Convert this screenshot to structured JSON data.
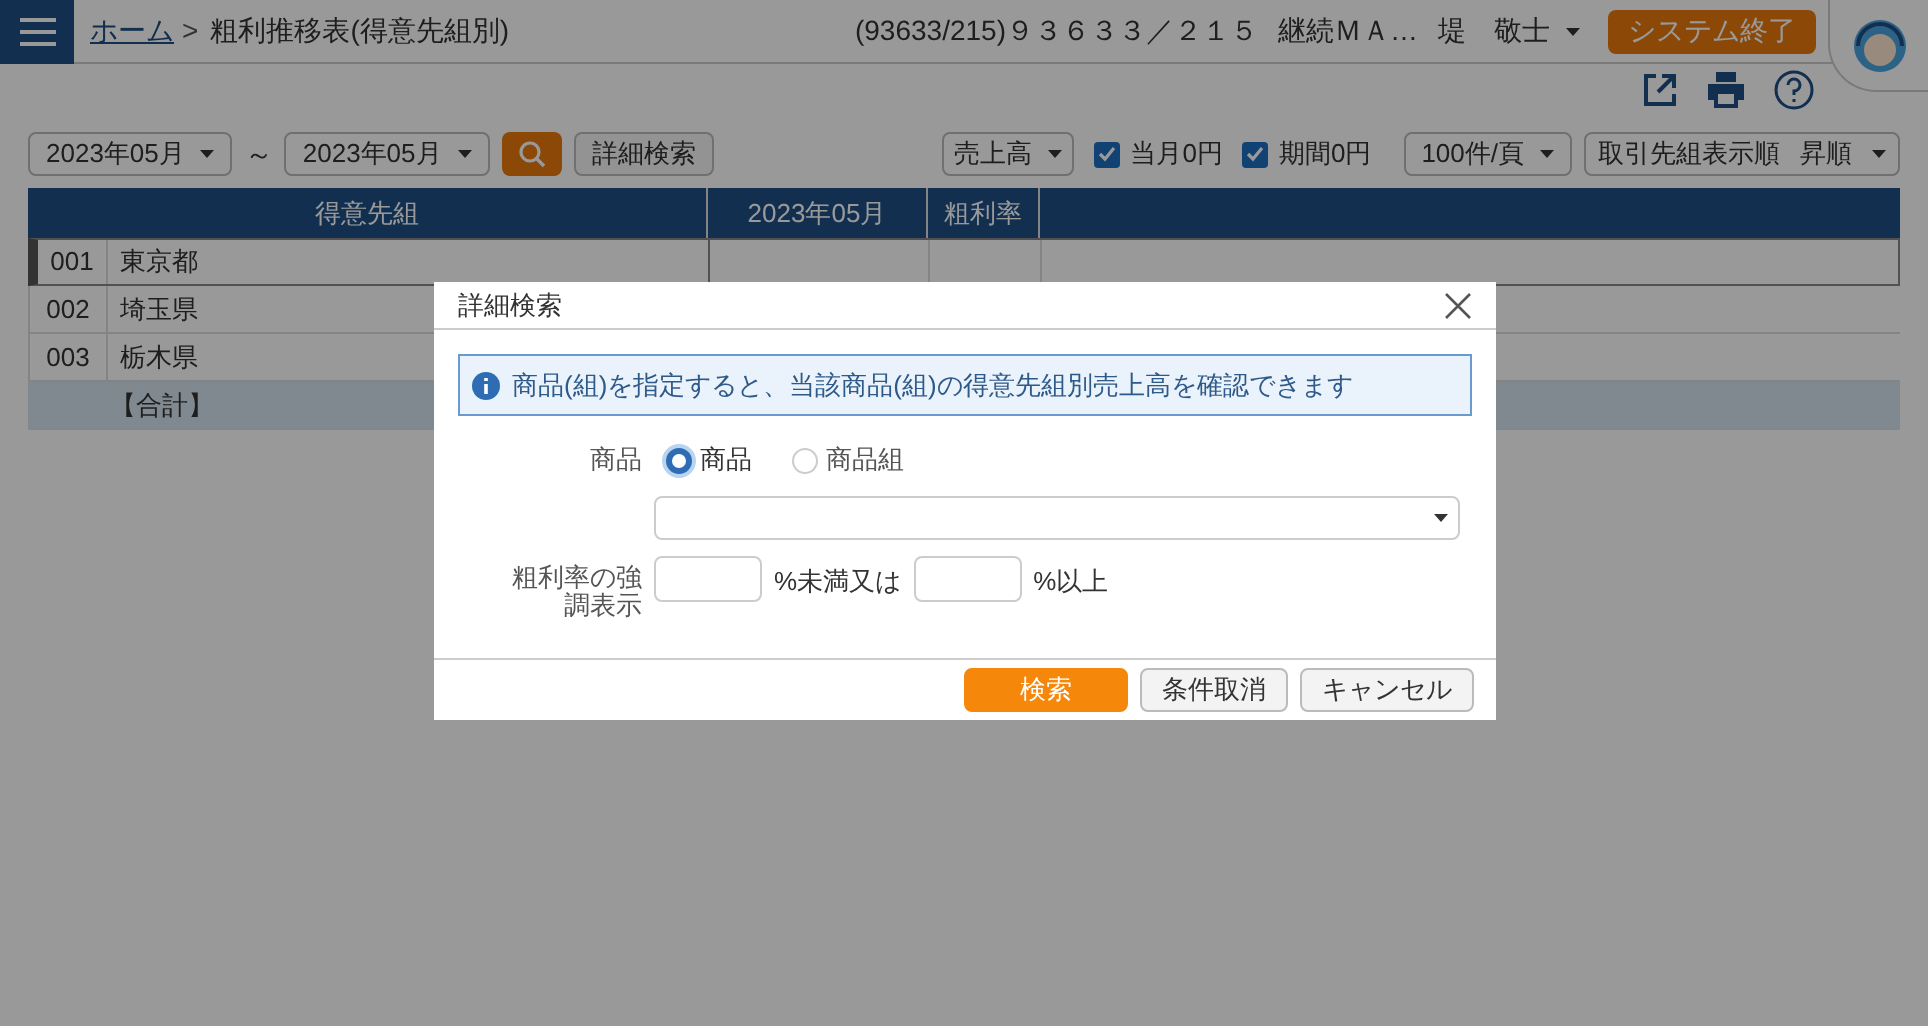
{
  "header": {
    "breadcrumb_link": "ホーム",
    "separator": ">",
    "page_title": "粗利推移表(得意先組別)",
    "account": "(93633/215)９３６３３／２１５",
    "company": "継続ＭＡ…",
    "user": "堤　敬士",
    "exit_button": "システム終了"
  },
  "toolbar": {
    "from_month": "2023年05月",
    "range_sep": "～",
    "to_month": "2023年05月",
    "detail_button": "詳細検索",
    "measure": "売上高",
    "checks": [
      {
        "label": "当月0円",
        "checked": true
      },
      {
        "label": "期間0円",
        "checked": true
      }
    ],
    "per_page": "100件/頁",
    "sort": "取引先組表示順",
    "order": "昇順"
  },
  "table": {
    "columns": [
      "得意先組",
      "2023年05月",
      "粗利率"
    ],
    "rows": [
      {
        "code": "001",
        "name": "東京都",
        "selected": true
      },
      {
        "code": "002",
        "name": "埼玉県",
        "selected": false
      },
      {
        "code": "003",
        "name": "栃木県",
        "selected": false
      }
    ],
    "total": "【合計】"
  },
  "dialog": {
    "title": "詳細検索",
    "info": "商品(組)を指定すると、当該商品(組)の得意先組別売上高を確認できます",
    "product_label": "商品",
    "radios": [
      {
        "label": "商品",
        "selected": true
      },
      {
        "label": "商品組",
        "selected": false
      }
    ],
    "highlight_label": "粗利率の強調表示",
    "below_suffix": "%未満又は",
    "above_suffix": "%以上",
    "buttons": [
      {
        "label": "検索",
        "kind": "primary"
      },
      {
        "label": "条件取消",
        "kind": "default"
      },
      {
        "label": "キャンセル",
        "kind": "default"
      }
    ]
  }
}
